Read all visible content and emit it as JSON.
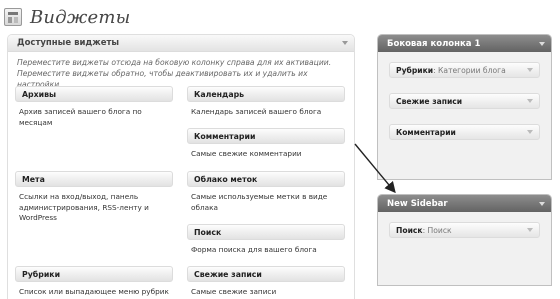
{
  "page": {
    "title": "Виджеты"
  },
  "available": {
    "title": "Доступные виджеты",
    "description": "Переместите виджеты отсюда на боковую колонку справа для их активации. Переместите виджеты обратно, чтобы деактивировать их и удалить их настройки.",
    "widgets": [
      {
        "label": "Архивы",
        "desc": "Архив записей вашего блога по месяцам"
      },
      {
        "label": "Календарь",
        "desc": "Календарь записей вашего блога"
      },
      {
        "label": "Комментарии",
        "desc": "Самые свежие комментарии"
      },
      {
        "label": "Мета",
        "desc": "Ссылки на вход/выход, панель администрирования, RSS-ленту и WordPress"
      },
      {
        "label": "Облако меток",
        "desc": "Самые используемые метки в виде облака"
      },
      {
        "label": "Поиск",
        "desc": "Форма поиска для вашего блога"
      },
      {
        "label": "Рубрики",
        "desc": "Список или выпадающее меню рубрик"
      },
      {
        "label": "Свежие записи",
        "desc": "Самые свежие записи"
      }
    ]
  },
  "sidebar1": {
    "title": "Боковая колонка 1",
    "widgets": [
      {
        "name": "Рубрики",
        "sub": ": Категории блога"
      },
      {
        "name": "Свежие записи",
        "sub": ""
      },
      {
        "name": "Комментарии",
        "sub": ""
      }
    ]
  },
  "sidebar2": {
    "title": "New Sidebar",
    "widgets": [
      {
        "name": "Поиск",
        "sub": ": Поиск"
      }
    ]
  }
}
